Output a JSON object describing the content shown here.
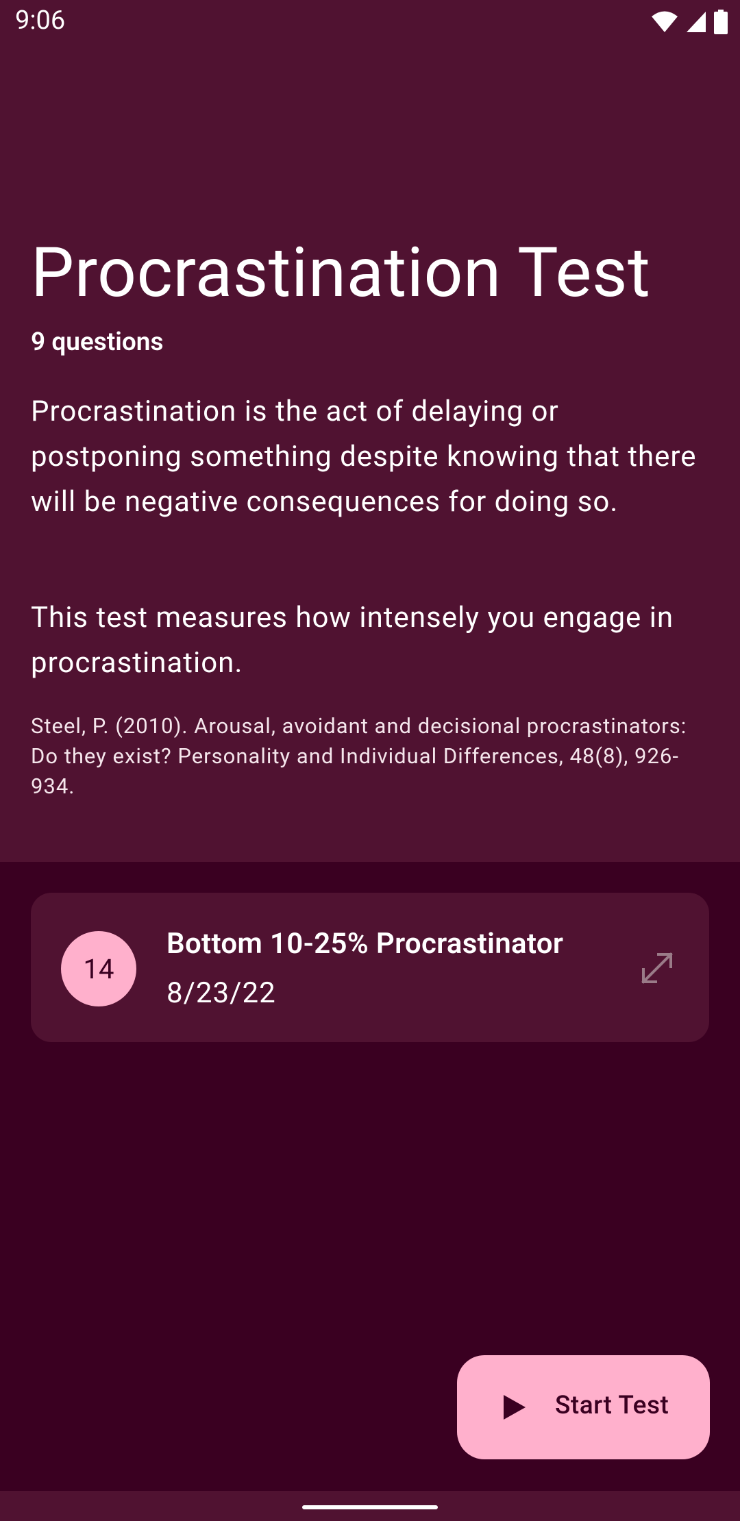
{
  "status_bar": {
    "time": "9:06"
  },
  "test": {
    "title": "Procrastination Test",
    "question_count": "9 questions",
    "description_1": "Procrastination is the act of delaying or postponing something despite knowing that there will be negative consequences for doing so.",
    "description_2": "This test measures how intensely you engage in procrastination.",
    "citation": "Steel, P. (2010). Arousal, avoidant and decisional procrastinators: Do they exist? Personality and Individual Differences, 48(8), 926-934."
  },
  "result": {
    "score": "14",
    "label": "Bottom 10-25% Procrastinator",
    "date": "8/23/22",
    "icon": "expand-icon"
  },
  "fab": {
    "label": "Start Test",
    "icon": "play-icon"
  },
  "colors": {
    "header_bg": "#501231",
    "body_bg": "#3a0021",
    "accent": "#ffb0cc"
  }
}
